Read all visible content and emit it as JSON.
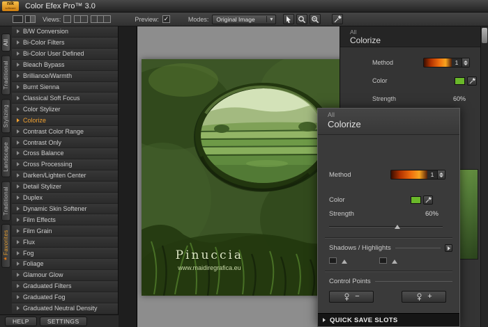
{
  "titlebar": {
    "logo_text": "nik",
    "logo_sub": "software",
    "title": "Color Efex Pro™ 3.0"
  },
  "toolbar": {
    "views_label": "Views:",
    "preview_label": "Preview:",
    "modes_label": "Modes:",
    "modes_value": "Original Image"
  },
  "side_tabs": {
    "items": [
      "All",
      "Traditional",
      "Stylizing",
      "Landscape",
      "Traditional",
      "Favorites"
    ]
  },
  "filter_list": {
    "selected": "Colorize",
    "items": [
      "B/W Conversion",
      "Bi-Color Filters",
      "Bi-Color User Defined",
      "Bleach Bypass",
      "Brilliance/Warmth",
      "Burnt Sienna",
      "Classical Soft Focus",
      "Color Stylizer",
      "Colorize",
      "Contrast Color Range",
      "Contrast Only",
      "Cross Balance",
      "Cross Processing",
      "Darken/Lighten Center",
      "Detail Stylizer",
      "Duplex",
      "Dynamic Skin Softener",
      "Film Effects",
      "Film Grain",
      "Flux",
      "Fog",
      "Foliage",
      "Glamour Glow",
      "Graduated Filters",
      "Graduated Fog",
      "Graduated Neutral Density"
    ]
  },
  "footer": {
    "help_label": "HELP",
    "settings_label": "SETTINGS"
  },
  "canvas": {
    "caption": "Pinuccia",
    "subcaption": "www.maidiregrafica.eu"
  },
  "right_panel": {
    "group_label": "All",
    "filter_label": "Colorize",
    "method_label": "Method",
    "method_value": "1",
    "color_label": "Color",
    "strength_label": "Strength",
    "strength_value": "60%"
  },
  "floating_panel": {
    "group_label": "All",
    "filter_label": "Colorize",
    "method_label": "Method",
    "method_value": "1",
    "color_label": "Color",
    "strength_label": "Strength",
    "strength_value": "60%",
    "shadows_label": "Shadows / Highlights",
    "control_points_label": "Control Points",
    "minus_label": "−",
    "plus_label": "+",
    "quick_save_label": "QUICK SAVE SLOTS"
  },
  "colors": {
    "selected_text": "#f0a030",
    "swatch_green": "#6ab82a",
    "accent_orange": "#ef6e0e"
  }
}
